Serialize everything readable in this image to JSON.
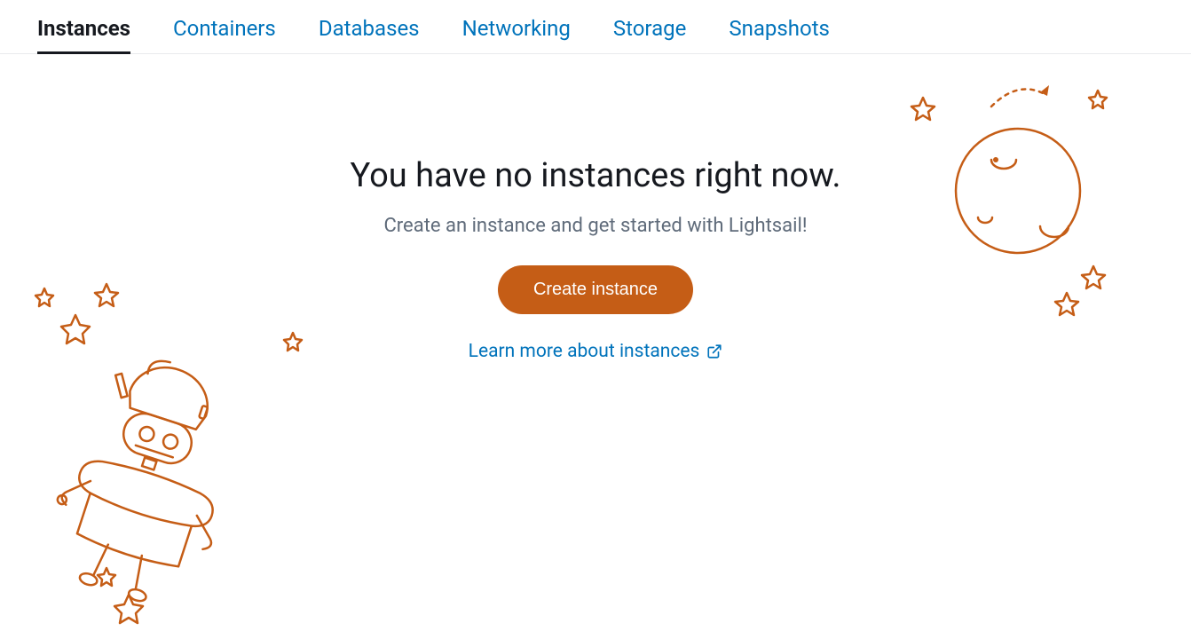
{
  "tabs": {
    "items": [
      {
        "label": "Instances",
        "active": true
      },
      {
        "label": "Containers",
        "active": false
      },
      {
        "label": "Databases",
        "active": false
      },
      {
        "label": "Networking",
        "active": false
      },
      {
        "label": "Storage",
        "active": false
      },
      {
        "label": "Snapshots",
        "active": false
      }
    ]
  },
  "empty": {
    "title": "You have no instances right now.",
    "subtitle": "Create an instance and get started with Lightsail!",
    "create_label": "Create instance",
    "learn_label": "Learn more about instances"
  },
  "colors": {
    "accent_orange": "#c55d16",
    "link_blue": "#0073bb",
    "text": "#16191f",
    "muted": "#5f6b7a"
  }
}
